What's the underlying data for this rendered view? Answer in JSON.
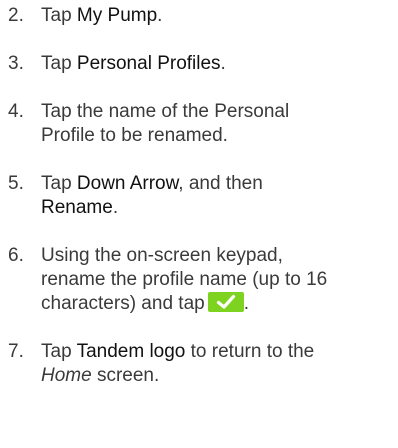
{
  "steps": [
    {
      "number": "2.",
      "parts": [
        {
          "text": "Tap ",
          "style": "normal"
        },
        {
          "text": "My Pump",
          "style": "bold"
        },
        {
          "text": ".",
          "style": "normal"
        }
      ]
    },
    {
      "number": "3.",
      "parts": [
        {
          "text": "Tap ",
          "style": "normal"
        },
        {
          "text": "Personal Profiles",
          "style": "bold"
        },
        {
          "text": ".",
          "style": "normal"
        }
      ]
    },
    {
      "number": "4.",
      "parts": [
        {
          "text": "Tap the name of the Personal",
          "style": "normal",
          "br": true
        },
        {
          "text": "Profile to be renamed.",
          "style": "normal"
        }
      ]
    },
    {
      "number": "5.",
      "parts": [
        {
          "text": "Tap ",
          "style": "normal"
        },
        {
          "text": "Down Arrow",
          "style": "bold"
        },
        {
          "text": ", and then",
          "style": "normal",
          "br": true
        },
        {
          "text": "Rename",
          "style": "bold"
        },
        {
          "text": ".",
          "style": "normal"
        }
      ]
    },
    {
      "number": "6.",
      "parts": [
        {
          "text": "Using the on-screen keypad,",
          "style": "normal",
          "br": true
        },
        {
          "text": "rename the profile name (up to 16",
          "style": "normal",
          "br": true
        },
        {
          "text": "characters) and tap",
          "style": "normal"
        },
        {
          "icon": "checkmark-button-icon"
        },
        {
          "text": ".",
          "style": "normal"
        }
      ]
    },
    {
      "number": "7.",
      "parts": [
        {
          "text": "Tap ",
          "style": "normal"
        },
        {
          "text": "Tandem logo",
          "style": "bold"
        },
        {
          "text": " to return to the",
          "style": "normal",
          "br": true
        },
        {
          "text": "Home",
          "style": "italic"
        },
        {
          "text": " screen.",
          "style": "normal"
        }
      ]
    }
  ],
  "colors": {
    "body_text": "#3a3a3a",
    "emphasis_text": "#111111",
    "check_button_bg": "#7ed321",
    "check_mark": "#ffffff"
  }
}
